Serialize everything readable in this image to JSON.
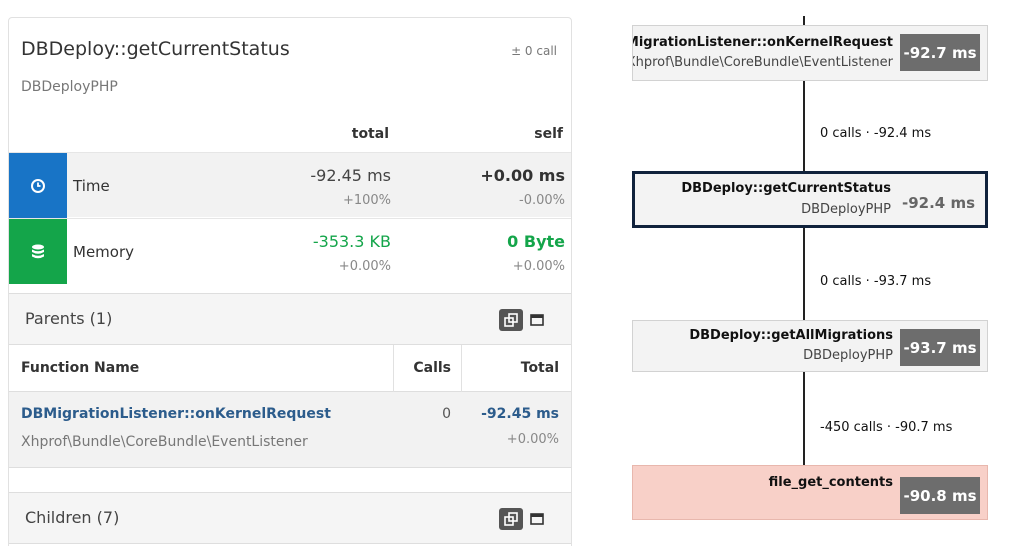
{
  "panel": {
    "title": "DBDeploy::getCurrentStatus",
    "call_diff": "± 0 call",
    "subtitle": "DBDeployPHP",
    "headers": {
      "total": "total",
      "self": "self"
    },
    "metrics": {
      "time": {
        "label": "Time",
        "total": "-92.45 ms",
        "total_pct": "+100%",
        "self": "+0.00 ms",
        "self_pct": "-0.00%"
      },
      "memory": {
        "label": "Memory",
        "total": "-353.3 KB",
        "total_pct": "+0.00%",
        "self": "0 Byte",
        "self_pct": "+0.00%"
      }
    },
    "parents": {
      "title": "Parents (1)",
      "columns": [
        "Function Name",
        "Calls",
        "Total"
      ],
      "rows": [
        {
          "name": "DBMigrationListener::onKernelRequest",
          "namespace": "Xhprof\\Bundle\\CoreBundle\\EventListener",
          "calls": "0",
          "total": "-92.45 ms",
          "total_pct": "+0.00%"
        }
      ]
    },
    "children": {
      "title": "Children (7)"
    }
  },
  "graph": {
    "nodes": [
      {
        "name": "DBMigrationListener::onKernelRequest",
        "namespace": "Xhprof\\Bundle\\CoreBundle\\EventListener",
        "time": "-92.7 ms"
      },
      {
        "name": "DBDeploy::getCurrentStatus",
        "namespace": "DBDeployPHP",
        "time": "-92.4 ms"
      },
      {
        "name": "DBDeploy::getAllMigrations",
        "namespace": "DBDeployPHP",
        "time": "-93.7 ms"
      },
      {
        "name": "file_get_contents",
        "namespace": "",
        "time": "-90.8 ms"
      }
    ],
    "edges": [
      {
        "label": "0 calls · -92.4 ms"
      },
      {
        "label": "0 calls · -93.7 ms"
      },
      {
        "label": "-450 calls · -90.7 ms"
      }
    ]
  },
  "colors": {
    "time": "#1874c6",
    "memory": "#14a54a",
    "selected_border": "#10223c",
    "hot_node": "#f8d0c8"
  },
  "icons": {
    "time": "clock-icon",
    "memory": "database-icon",
    "expand": "expand-icon",
    "collapse": "window-icon"
  }
}
